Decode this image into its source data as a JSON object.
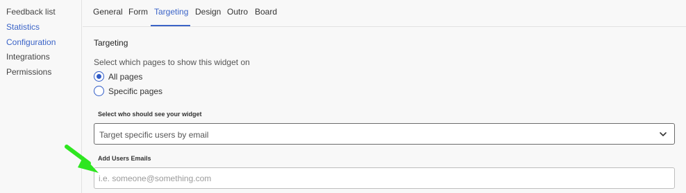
{
  "sidebar": {
    "items": [
      {
        "label": "Feedback list"
      },
      {
        "label": "Statistics"
      },
      {
        "label": "Configuration"
      },
      {
        "label": "Integrations"
      },
      {
        "label": "Permissions"
      }
    ]
  },
  "tabs": [
    {
      "label": "General"
    },
    {
      "label": "Form"
    },
    {
      "label": "Targeting",
      "active": true
    },
    {
      "label": "Design"
    },
    {
      "label": "Outro"
    },
    {
      "label": "Board"
    }
  ],
  "targeting": {
    "title": "Targeting",
    "pages_question": "Select which pages to show this widget on",
    "page_options": [
      {
        "label": "All pages",
        "selected": true
      },
      {
        "label": "Specific pages",
        "selected": false
      }
    ],
    "audience_label": "Select who should see your widget",
    "audience_select": {
      "value": "Target specific users by email",
      "icon": "chevron-down-icon"
    },
    "emails_label": "Add Users Emails",
    "emails_input": {
      "value": "",
      "placeholder": "i.e. someone@something.com"
    }
  },
  "colors": {
    "accent": "#3a63c7",
    "annotation_arrow": "#2ee620"
  }
}
